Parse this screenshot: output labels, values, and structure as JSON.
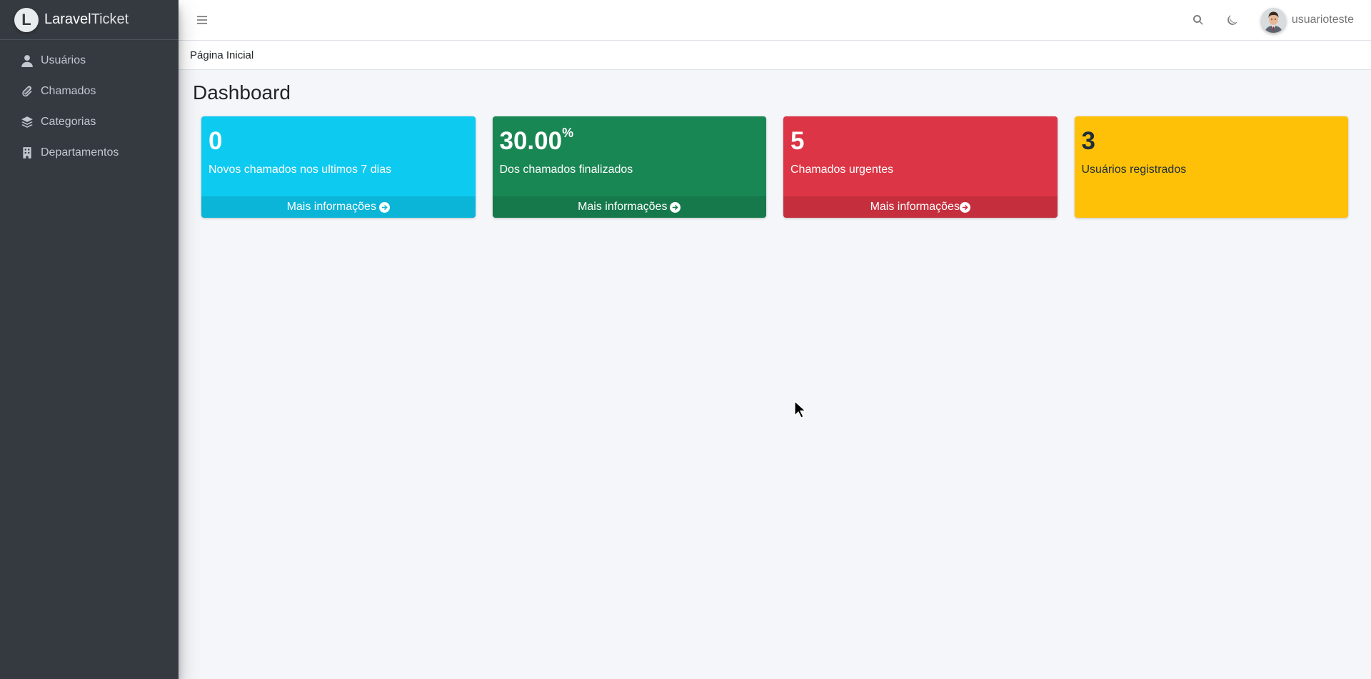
{
  "brand": {
    "logo_letter": "L",
    "name_bold": "Laravel",
    "name_light": "Ticket"
  },
  "sidebar": {
    "items": [
      {
        "label": "Usuários",
        "icon": "user-icon"
      },
      {
        "label": "Chamados",
        "icon": "paperclip-icon"
      },
      {
        "label": "Categorias",
        "icon": "layers-icon"
      },
      {
        "label": "Departamentos",
        "icon": "building-icon"
      }
    ]
  },
  "navbar": {
    "user_name": "usuarioteste",
    "icons": [
      "hamburger-icon",
      "search-icon",
      "moon-icon"
    ]
  },
  "breadcrumb": "Página Inicial",
  "page_title": "Dashboard",
  "cards": [
    {
      "value": "0",
      "suffix": "",
      "description": "Novos chamados nos ultimos 7 dias",
      "footer": "Mais informações",
      "color": "#0dcaf0"
    },
    {
      "value": "30.00",
      "suffix": "%",
      "description": "Dos chamados finalizados",
      "footer": "Mais informações",
      "color": "#198754"
    },
    {
      "value": "5",
      "suffix": "",
      "description": "Chamados urgentes",
      "footer": "Mais informações",
      "color": "#dc3545"
    },
    {
      "value": "3",
      "suffix": "",
      "description": "Usuários registrados",
      "footer": "",
      "color": "#ffc107"
    }
  ]
}
